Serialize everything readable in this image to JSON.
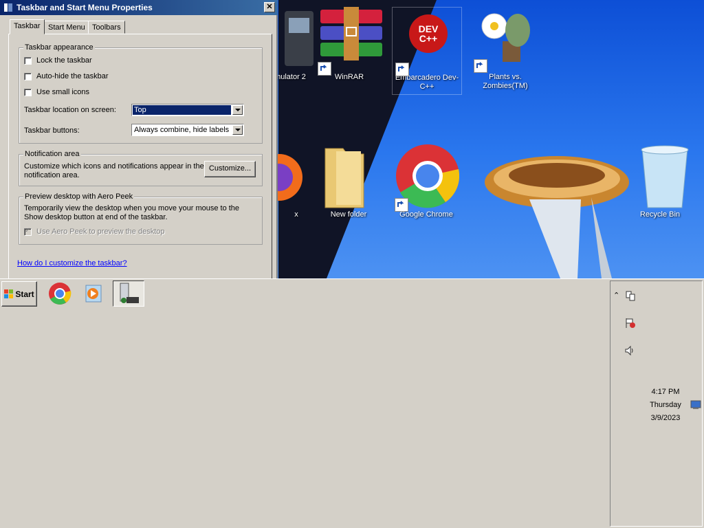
{
  "desktop": {
    "icons": [
      {
        "label": "mulator 2"
      },
      {
        "label": "WinRAR"
      },
      {
        "label": "Embarcadero Dev-C++",
        "badge": "DEV C++"
      },
      {
        "label": "Plants vs. Zombies(TM)"
      },
      {
        "label": "x"
      },
      {
        "label": "New folder"
      },
      {
        "label": "Google Chrome"
      },
      {
        "label": "Recycle Bin"
      }
    ]
  },
  "dialog": {
    "title": "Taskbar and Start Menu Properties",
    "close_label": "✕",
    "tabs": [
      {
        "label": "Taskbar"
      },
      {
        "label": "Start Menu"
      },
      {
        "label": "Toolbars"
      }
    ],
    "appearance": {
      "title": "Taskbar appearance",
      "lock_label": "Lock the taskbar",
      "autohide_label": "Auto-hide the taskbar",
      "small_icons_label": "Use small icons",
      "location_label": "Taskbar location on screen:",
      "location_value": "Top",
      "buttons_label": "Taskbar buttons:",
      "buttons_value": "Always combine, hide labels"
    },
    "notification": {
      "title": "Notification area",
      "text": "Customize which icons and notifications appear in the notification area.",
      "customize_label": "Customize..."
    },
    "aero_peek": {
      "title": "Preview desktop with Aero Peek",
      "text": "Temporarily view the desktop when you move your mouse to the Show desktop button at end of the taskbar.",
      "checkbox_label": "Use Aero Peek to preview the desktop"
    },
    "help_link": "How do I customize the taskbar?"
  },
  "taskbar": {
    "start_label": "Start",
    "buttons": [
      {
        "icon": "chrome-icon"
      },
      {
        "icon": "media-player-icon"
      },
      {
        "icon": "control-panel-icon"
      }
    ],
    "tray": {
      "time": "4:17 PM",
      "day": "Thursday",
      "date": "3/9/2023"
    }
  }
}
